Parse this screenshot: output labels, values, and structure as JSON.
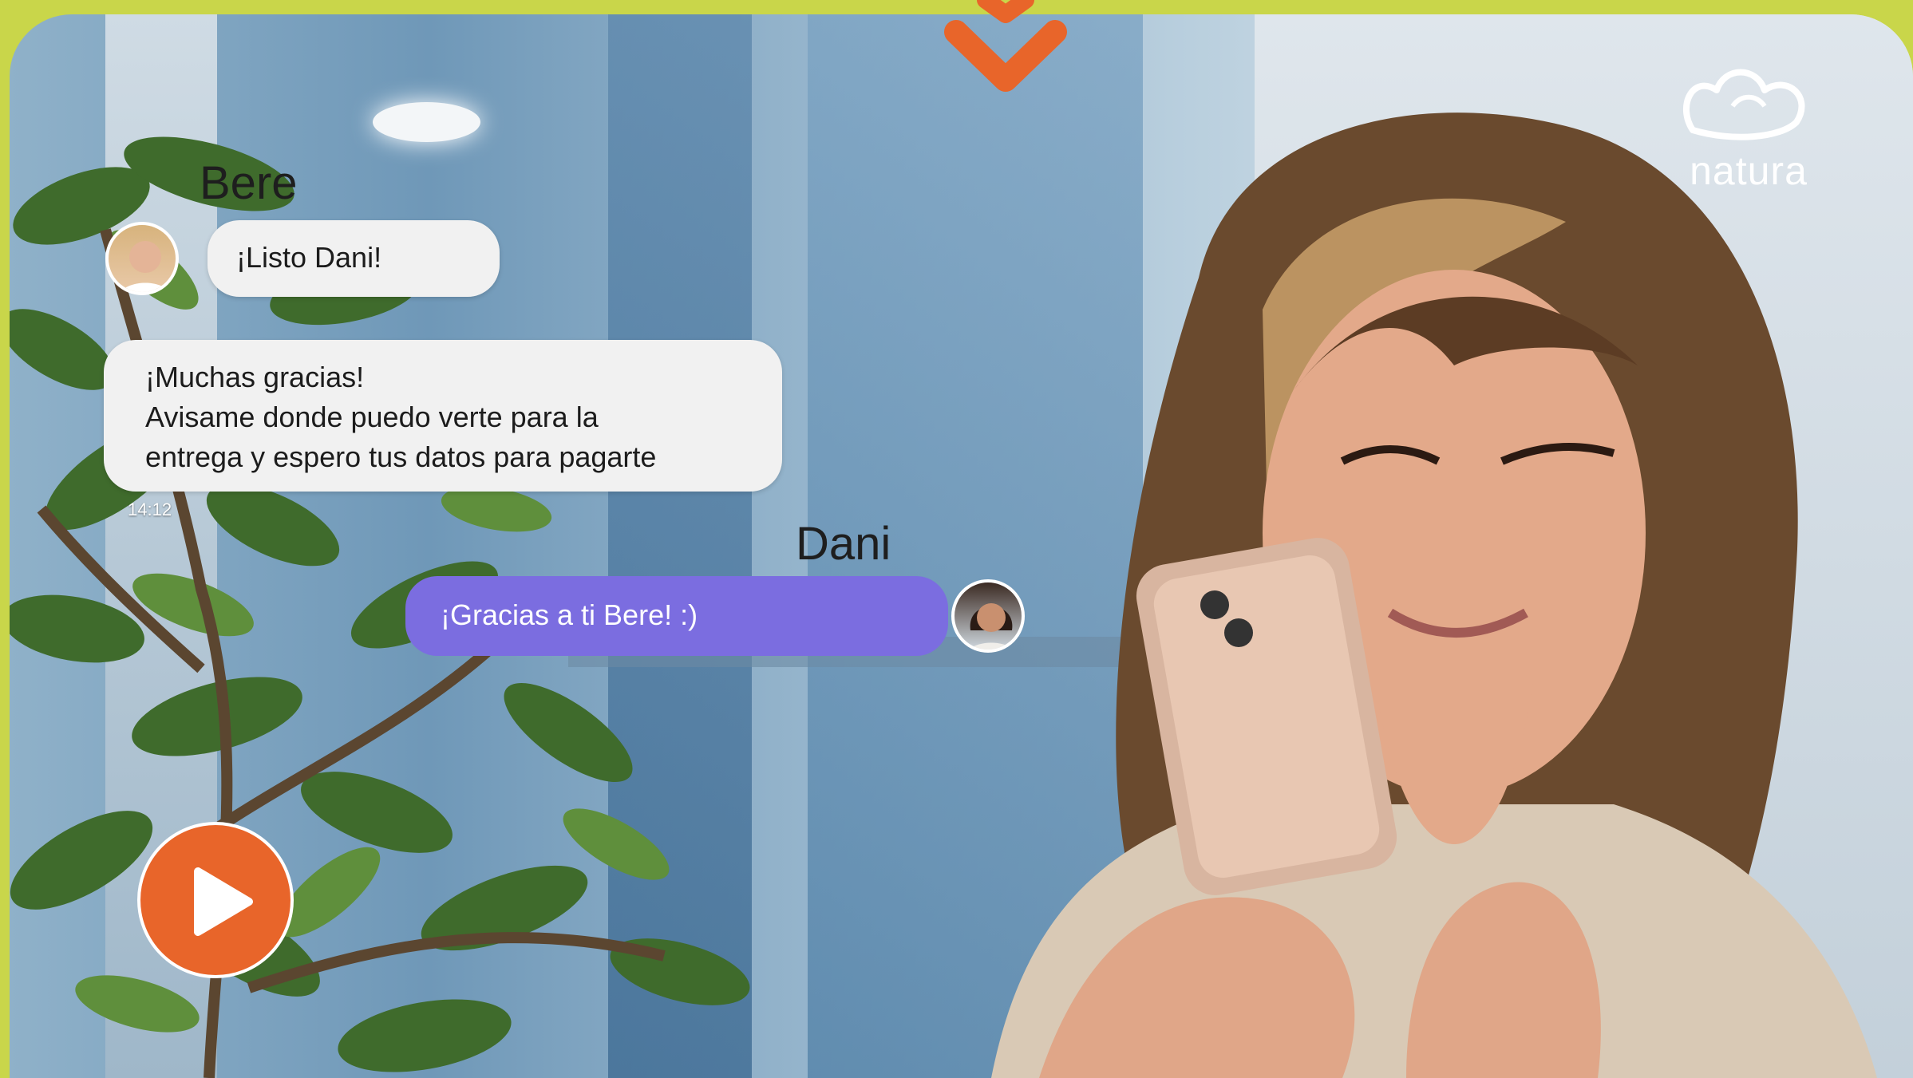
{
  "video": {
    "brand": "natura",
    "chat": {
      "messages": [
        {
          "sender": "Bere",
          "text": "¡Listo Dani!"
        },
        {
          "lines": [
            "¡Muchas gracias!",
            "Avisame donde puedo verte para la",
            "entrega y espero tus datos para pagarte"
          ],
          "time": "14:12"
        },
        {
          "sender": "Dani",
          "text": "¡Gracias a ti Bere! :)"
        }
      ]
    }
  },
  "colors": {
    "page_background": "#c9d64a",
    "accent_orange": "#e8652a",
    "sent_bubble": "#7b6de0",
    "received_bubble": "#f1f1f1"
  },
  "icons": {
    "scroll_indicator": "chevron-down-icon",
    "play": "play-icon",
    "logo": "natura-leaf-logo"
  }
}
